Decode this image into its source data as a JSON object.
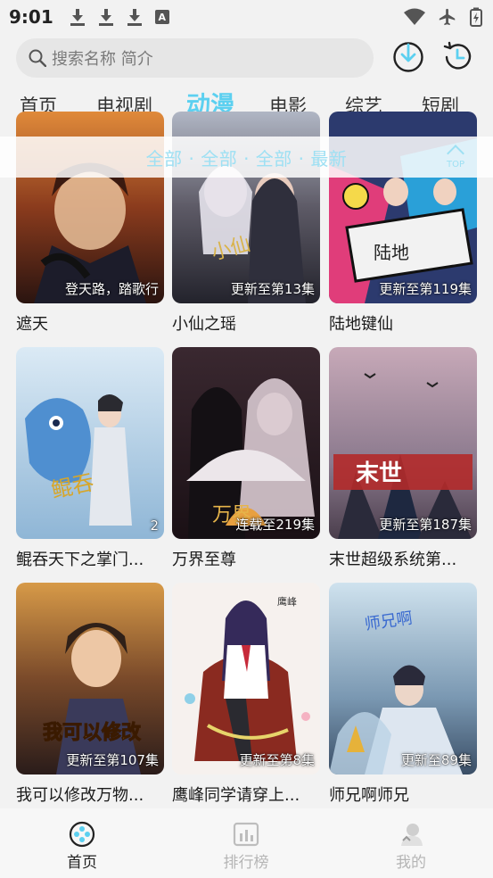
{
  "status_bar": {
    "time": "9:01"
  },
  "search": {
    "placeholder": "搜索名称 简介"
  },
  "tabs": [
    {
      "label": "首页"
    },
    {
      "label": "电视剧"
    },
    {
      "label": "动漫"
    },
    {
      "label": "电影"
    },
    {
      "label": "综艺"
    },
    {
      "label": "短剧"
    }
  ],
  "active_tab": "动漫",
  "filter": {
    "text": "全部 · 全部 · 全部 · 最新",
    "top_label": "TOP"
  },
  "items": [
    {
      "title": "遮天",
      "badge": "登天路，踏歌行"
    },
    {
      "title": "小仙之瑶",
      "badge": "更新至第13集"
    },
    {
      "title": "陆地键仙",
      "badge": "更新至第119集"
    },
    {
      "title": "鲲吞天下之掌门...",
      "badge": "2"
    },
    {
      "title": "万界至尊",
      "badge": "连载至219集"
    },
    {
      "title": "末世超级系统第...",
      "badge": "更新至第187集"
    },
    {
      "title": "我可以修改万物...",
      "badge": "更新至第107集"
    },
    {
      "title": "鹰峰同学请穿上...",
      "badge": "更新至第8集"
    },
    {
      "title": "师兄啊师兄",
      "badge": "更新至89集"
    }
  ],
  "bottom_nav": [
    {
      "label": "首页",
      "icon": "film-reel-icon"
    },
    {
      "label": "排行榜",
      "icon": "chart-icon"
    },
    {
      "label": "我的",
      "icon": "profile-icon"
    }
  ],
  "colors": {
    "accent": "#5cd0f0",
    "filter": "#9ee0f3"
  }
}
